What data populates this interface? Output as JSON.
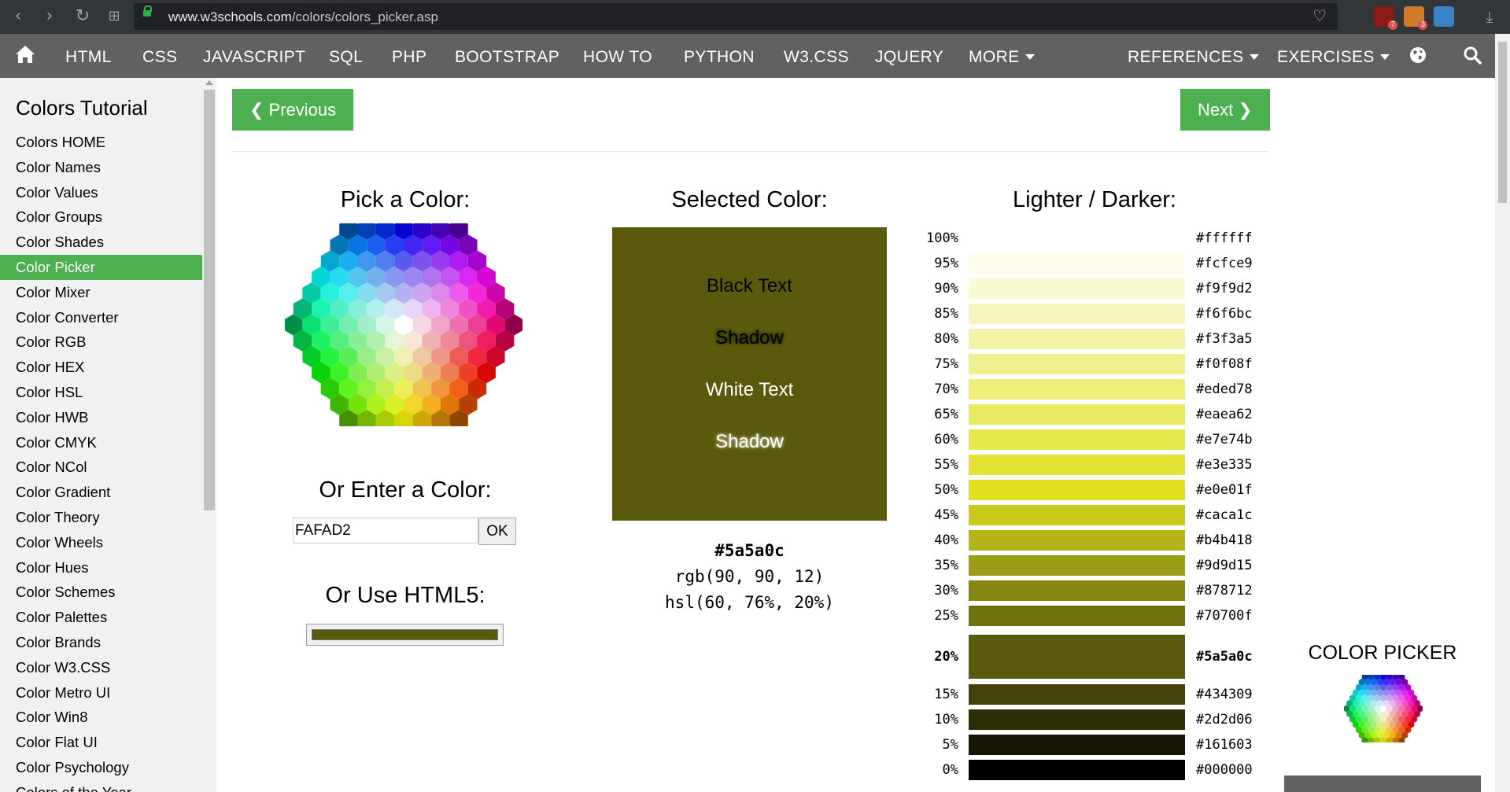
{
  "browser": {
    "url_host": "www.w3schools.com",
    "url_path": "/colors/colors_picker.asp",
    "extensions": [
      {
        "name": "ublock-icon",
        "color": "#8b1a1a",
        "count": "7"
      },
      {
        "name": "cookie-icon",
        "color": "#d07a2a",
        "count": "3"
      },
      {
        "name": "tab-manager-icon",
        "color": "#3b82c4",
        "count": ""
      }
    ]
  },
  "topnav": {
    "items": [
      "HTML",
      "CSS",
      "JAVASCRIPT",
      "SQL",
      "PHP",
      "BOOTSTRAP",
      "HOW TO",
      "PYTHON",
      "W3.CSS",
      "JQUERY",
      "MORE"
    ],
    "right_items": [
      "REFERENCES",
      "EXERCISES"
    ]
  },
  "sidebar": {
    "title": "Colors Tutorial",
    "items": [
      "Colors HOME",
      "Color Names",
      "Color Values",
      "Color Groups",
      "Color Shades",
      "Color Picker",
      "Color Mixer",
      "Color Converter",
      "Color RGB",
      "Color HEX",
      "Color HSL",
      "Color HWB",
      "Color CMYK",
      "Color NCol",
      "Color Gradient",
      "Color Theory",
      "Color Wheels",
      "Color Hues",
      "Color Schemes",
      "Color Palettes",
      "Color Brands",
      "Color W3.CSS",
      "Color Metro UI",
      "Color Win8",
      "Color Flat UI",
      "Color Psychology",
      "Colors of the Year"
    ],
    "active": "Color Picker"
  },
  "pager": {
    "prev": "❮ Previous",
    "next": "Next ❯"
  },
  "picker": {
    "pick_heading": "Pick a Color:",
    "enter_heading": "Or Enter a Color:",
    "input_value": "FAFAD2",
    "ok_label": "OK",
    "html5_heading": "Or Use HTML5:",
    "html5_value": "#5a5a0c"
  },
  "selected": {
    "heading": "Selected Color:",
    "color": "#5a5a0c",
    "black_text": "Black Text",
    "black_shadow": "Shadow",
    "white_text": "White Text",
    "white_shadow": "Shadow",
    "hex": "#5a5a0c",
    "rgb": "rgb(90, 90, 12)",
    "hsl": "hsl(60, 76%, 20%)"
  },
  "shades": {
    "heading": "Lighter / Darker:",
    "rows": [
      {
        "pct": "100%",
        "hex": "#ffffff"
      },
      {
        "pct": "95%",
        "hex": "#fcfce9"
      },
      {
        "pct": "90%",
        "hex": "#f9f9d2"
      },
      {
        "pct": "85%",
        "hex": "#f6f6bc"
      },
      {
        "pct": "80%",
        "hex": "#f3f3a5"
      },
      {
        "pct": "75%",
        "hex": "#f0f08f"
      },
      {
        "pct": "70%",
        "hex": "#eded78"
      },
      {
        "pct": "65%",
        "hex": "#eaea62"
      },
      {
        "pct": "60%",
        "hex": "#e7e74b"
      },
      {
        "pct": "55%",
        "hex": "#e3e335"
      },
      {
        "pct": "50%",
        "hex": "#e0e01f"
      },
      {
        "pct": "45%",
        "hex": "#caca1c"
      },
      {
        "pct": "40%",
        "hex": "#b4b418"
      },
      {
        "pct": "35%",
        "hex": "#9d9d15"
      },
      {
        "pct": "30%",
        "hex": "#878712"
      },
      {
        "pct": "25%",
        "hex": "#70700f"
      },
      {
        "pct": "20%",
        "hex": "#5a5a0c",
        "selected": true
      },
      {
        "pct": "15%",
        "hex": "#434309"
      },
      {
        "pct": "10%",
        "hex": "#2d2d06"
      },
      {
        "pct": "5%",
        "hex": "#161603"
      },
      {
        "pct": "0%",
        "hex": "#000000"
      }
    ]
  },
  "ad": {
    "title": "COLOR PICKER"
  }
}
